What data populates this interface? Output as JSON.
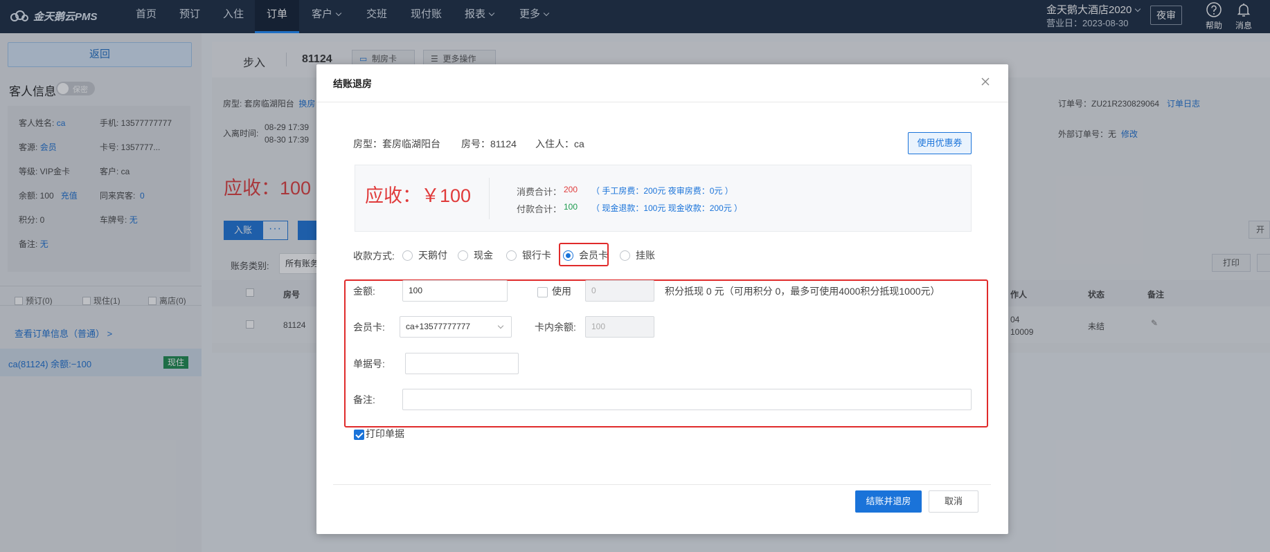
{
  "nav": {
    "logo": "金天鹅云PMS",
    "items": [
      "首页",
      "预订",
      "入住",
      "订单",
      "客户",
      "交班",
      "现付账",
      "报表",
      "更多"
    ],
    "active_index": 3,
    "hotel_name": "金天鹅大酒店2020",
    "business_date": "营业日：2023-08-30",
    "night_audit": "夜审",
    "help": "帮助",
    "messages": "消息"
  },
  "left": {
    "back": "返回",
    "guest_info_title": "客人信息",
    "privacy_toggle": "保密",
    "fields": {
      "name_label": "客人姓名:",
      "name_value": "ca",
      "phone": "手机: 13577777777",
      "source_label": "客源:",
      "source_value": "会员",
      "card": "卡号: 1357777...",
      "level": "等级: VIP金卡",
      "customer": "客户: ca",
      "balance": "余额: 100",
      "recharge": "充值",
      "companions_label": "同来宾客:",
      "companions_value": "0",
      "points": "积分: 0",
      "plate_label": "车牌号:",
      "plate_value": "无",
      "remark_label": "备注:",
      "remark_value": "无"
    },
    "filters": [
      "预订(0)",
      "现住(1)",
      "离店(0)"
    ],
    "view_order": "查看订单信息（普通） >",
    "guest_row": "ca(81124)   余额:−100",
    "guest_badge": "现住"
  },
  "main": {
    "walkin": "步入",
    "room_no": "81124",
    "make_card": "制房卡",
    "more_ops": "更多操作",
    "room_type_label": "房型:",
    "room_type_value": "套房临湖阳台",
    "change_room": "换房",
    "checkin_time_label": "入离时间:",
    "checkin_time": "08-29 17:39",
    "checkout_time": "08-30 17:39",
    "order_no": "订单号：ZU21R230829064",
    "order_log": "订单日志",
    "ext_order_label": "外部订单号：无",
    "ext_order_edit": "修改",
    "receivable": "应收：100",
    "post_btn": "入账",
    "account_type_label": "账务类别:",
    "account_type_value": "所有账务",
    "print_btn": "打印",
    "open_btn": "开",
    "table_headers": {
      "room": "房号",
      "operator": "作人",
      "status": "状态",
      "remark": "备注"
    },
    "table_row": {
      "room": "81124",
      "op1": "04",
      "op2": "10009",
      "status": "未结"
    }
  },
  "modal": {
    "title": "结账退房",
    "room_type": "房型：套房临湖阳台",
    "room_no": "房号：81124",
    "guest": "入住人：ca",
    "coupon": "使用优惠券",
    "due": "应收：￥100",
    "consume_label": "消费合计：",
    "consume_value": "200",
    "consume_detail": "（ 手工房费：200元   夜审房费：0元 ）",
    "paid_label": "付款合计：",
    "paid_value": "100",
    "paid_detail": "（ 现金退款：100元   现金收款：200元 ）",
    "pay_method_label": "收款方式:",
    "pay_methods": [
      "天鹅付",
      "现金",
      "银行卡",
      "会员卡",
      "挂账"
    ],
    "selected_method": "会员卡",
    "amount_label": "金额:",
    "amount_value": "100",
    "use_label": "使用",
    "points_input": "0",
    "points_hint": "积分抵现 0 元（可用积分 0，最多可使用4000积分抵现1000元）",
    "card_label": "会员卡:",
    "card_value": "ca+13577777777",
    "card_balance_label": "卡内余额:",
    "card_balance_value": "100",
    "receipt_label": "单据号:",
    "receipt_value": "",
    "remark_label": "备注:",
    "remark_value": "",
    "print_receipt": "打印单据",
    "print_receipt_checked": true,
    "confirm": "结账并退房",
    "cancel": "取消"
  }
}
